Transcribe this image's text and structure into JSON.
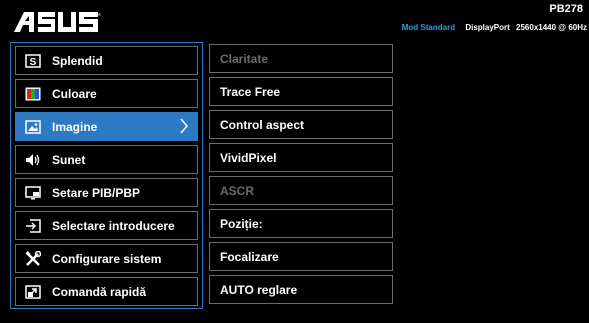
{
  "header": {
    "brand": "ASUS",
    "model": "PB278",
    "mode": "Mod Standard",
    "input": "DisplayPort",
    "resolution": "2560x1440 @ 60Hz"
  },
  "menu": {
    "items": [
      {
        "label": "Splendid",
        "icon": "splendid-s-icon"
      },
      {
        "label": "Culoare",
        "icon": "color-icon"
      },
      {
        "label": "Imagine",
        "icon": "image-icon",
        "selected": true
      },
      {
        "label": "Sunet",
        "icon": "speaker-icon"
      },
      {
        "label": "Setare PIB/PBP",
        "icon": "pip-icon"
      },
      {
        "label": "Selectare introducere",
        "icon": "input-select-icon"
      },
      {
        "label": "Configurare sistem",
        "icon": "tools-icon"
      },
      {
        "label": "Comandă rapidă",
        "icon": "shortcut-icon"
      }
    ]
  },
  "submenu": {
    "items": [
      {
        "label": "Claritate",
        "enabled": false
      },
      {
        "label": "Trace Free",
        "enabled": true
      },
      {
        "label": "Control aspect",
        "enabled": true
      },
      {
        "label": "VividPixel",
        "enabled": true
      },
      {
        "label": "ASCR",
        "enabled": false
      },
      {
        "label": "Poziție:",
        "enabled": true
      },
      {
        "label": "Focalizare",
        "enabled": true
      },
      {
        "label": "AUTO reglare",
        "enabled": true
      }
    ]
  },
  "colors": {
    "accent": "#2e79c3",
    "mode_text": "#2d9de0",
    "border": "#6c6c6c",
    "disabled_text": "#6a6a6a"
  }
}
